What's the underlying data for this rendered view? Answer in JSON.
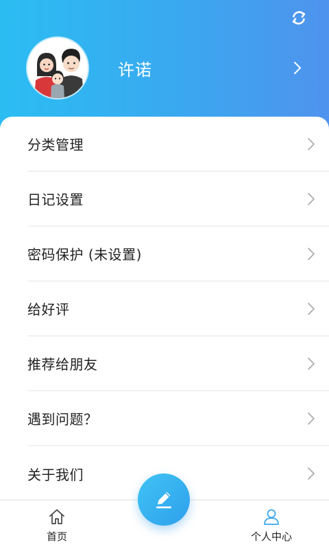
{
  "header": {
    "sync_icon": "sync-icon",
    "profile": {
      "name": "许诺",
      "avatar_icon": "family-avatar"
    }
  },
  "menu": {
    "items": [
      {
        "label": "分类管理"
      },
      {
        "label": "日记设置"
      },
      {
        "label": "密码保护 (未设置)"
      },
      {
        "label": "给好评"
      },
      {
        "label": "推荐给朋友"
      },
      {
        "label": "遇到问题？"
      },
      {
        "label": "关于我们"
      }
    ]
  },
  "tabbar": {
    "home_label": "首页",
    "profile_label": "个人中心",
    "compose_icon": "pencil-icon"
  },
  "colors": {
    "header_start": "#2bbdf2",
    "header_end": "#4f93ee",
    "accent": "#3aa8f0"
  }
}
